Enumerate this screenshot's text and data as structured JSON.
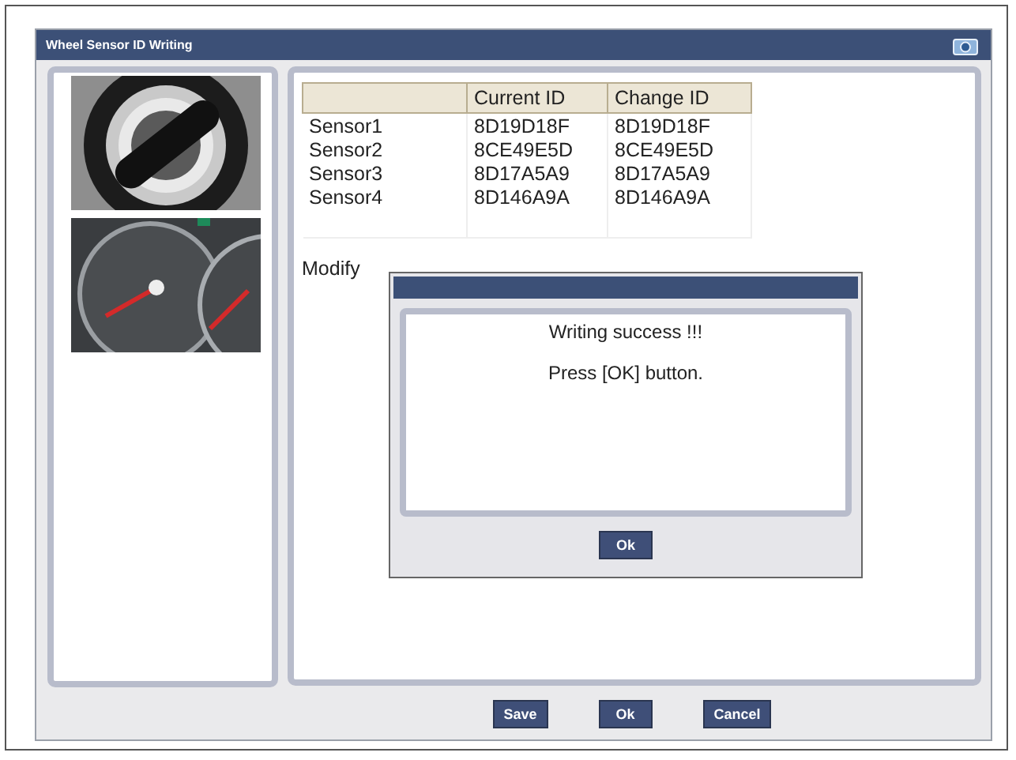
{
  "window": {
    "title": "Wheel Sensor ID Writing"
  },
  "pictures": [
    {
      "kind": "picture"
    },
    {
      "kind": "picture"
    }
  ],
  "table": {
    "columns": [
      "Current ID",
      "Change ID"
    ],
    "rows": [
      {
        "name": "Sensor1",
        "current": "8D19D18F",
        "change": "8D19D18F"
      },
      {
        "name": "Sensor2",
        "current": "8CE49E5D",
        "change": "8CE49E5D"
      },
      {
        "name": "Sensor3",
        "current": "8D17A5A9",
        "change": "8D17A5A9"
      },
      {
        "name": "Sensor4",
        "current": "8D146A9A",
        "change": "8D146A9A"
      }
    ]
  },
  "modify_label": "Modify",
  "dialog": {
    "message": "Writing success !!!",
    "instruction": "Press [OK] button.",
    "button": "Ok"
  },
  "buttons": [
    "Save",
    "Ok",
    "Cancel"
  ]
}
